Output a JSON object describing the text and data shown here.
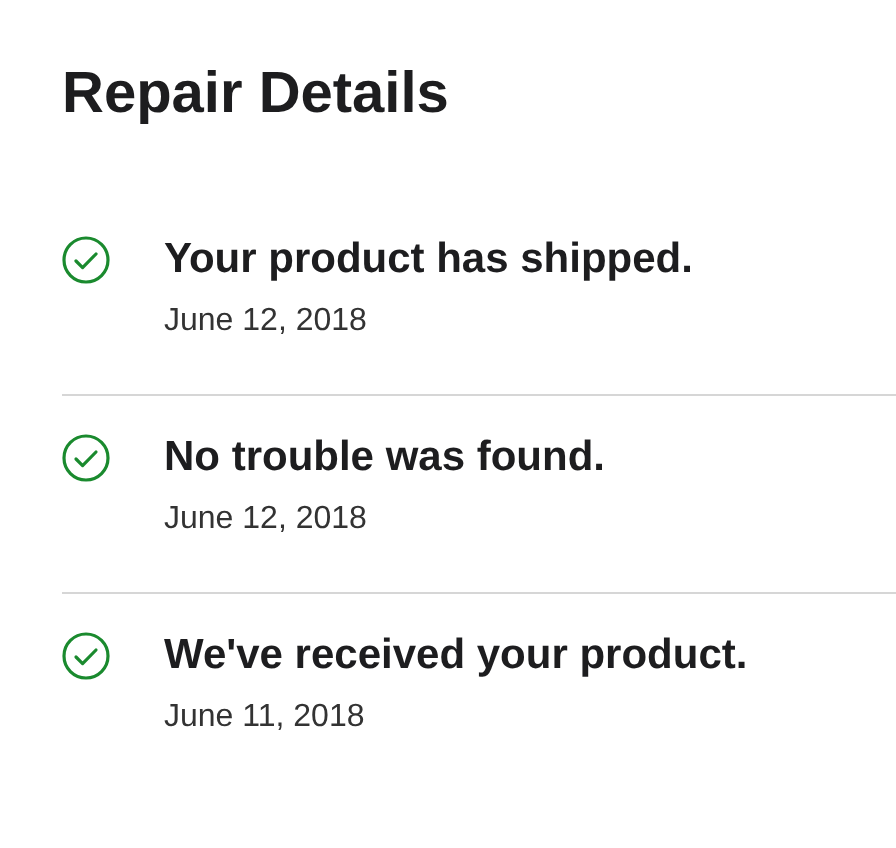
{
  "title": "Repair Details",
  "events": [
    {
      "status": "Your product has shipped.",
      "date": "June 12, 2018",
      "done": true
    },
    {
      "status": "No trouble was found.",
      "date": "June 12, 2018",
      "done": true
    },
    {
      "status": "We've received your product.",
      "date": "June 11, 2018",
      "done": true
    }
  ]
}
